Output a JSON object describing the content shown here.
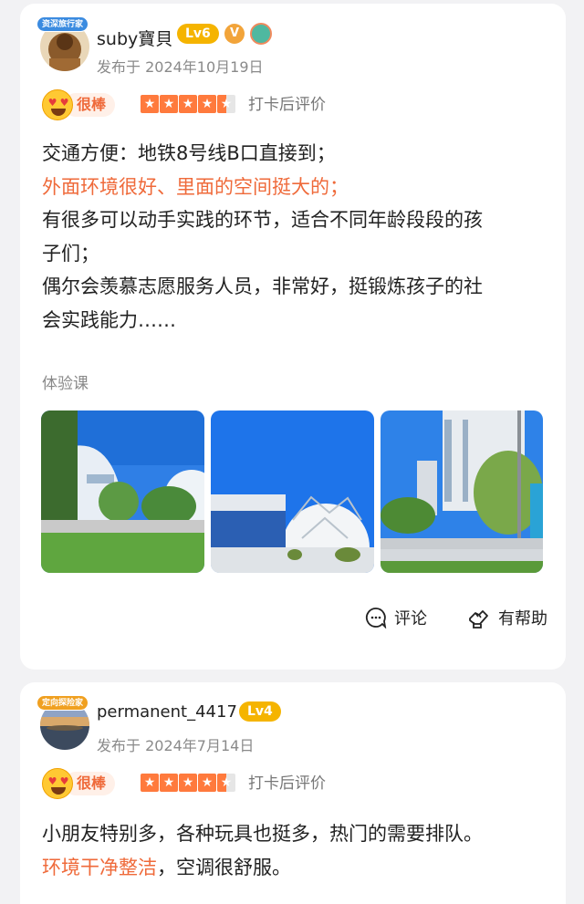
{
  "reviews": [
    {
      "avatar_badge": "资深旅行家",
      "username": "suby寶貝",
      "level": "Lv6",
      "verified_badge": "V",
      "date": "发布于 2024年10月19日",
      "rating_label": "很棒",
      "stars": 4.5,
      "checkin_label": "打卡后评价",
      "text_lines": [
        {
          "text": "交通方便：地铁8号线B口直接到；",
          "highlight": false
        },
        {
          "text": "外面环境很好、里面的空间挺大的；",
          "highlight": true
        },
        {
          "text": "有很多可以动手实践的环节，适合不同年龄段段的孩",
          "highlight": false
        },
        {
          "text": "子们；",
          "highlight": false
        },
        {
          "text": "偶尔会羡慕志愿服务人员，非常好，挺锻炼孩子的社",
          "highlight": false
        },
        {
          "text": "会实践能力……",
          "highlight": false
        }
      ],
      "course_label": "体验课",
      "comment_label": "评论",
      "helpful_label": "有帮助"
    },
    {
      "avatar_badge": "定向探险家",
      "username": "permanent_4417",
      "level": "Lv4",
      "date": "发布于 2024年7月14日",
      "rating_label": "很棒",
      "stars": 4.5,
      "checkin_label": "打卡后评价",
      "text_line1": "小朋友特别多，各种玩具也挺多，热门的需要排队。",
      "text_line2_highlight": "环境干净整洁",
      "text_line2_rest": "，空调很舒服。"
    }
  ],
  "colors": {
    "accent_orange": "#ef6a3a",
    "level_gold": "#f5b400",
    "sky_blue": "#2f7fe6"
  }
}
